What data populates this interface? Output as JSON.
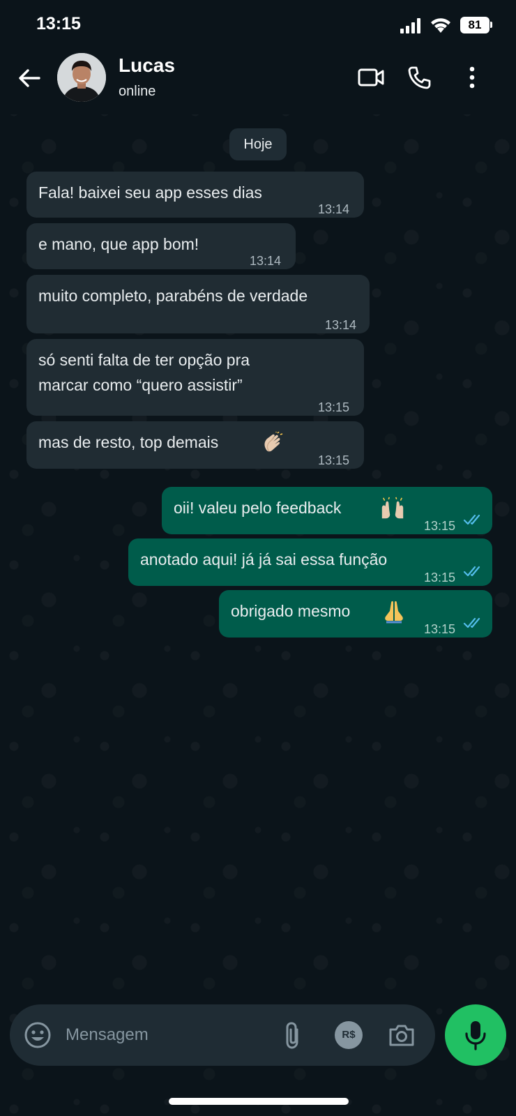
{
  "status_bar": {
    "time": "13:15",
    "battery": "81"
  },
  "header": {
    "contact_name": "Lucas",
    "contact_status": "online"
  },
  "date_chip": "Hoje",
  "messages": [
    {
      "direction": "in",
      "text": "Fala! baixei seu app esses dias",
      "time": "13:14"
    },
    {
      "direction": "in",
      "text": "e mano, que app bom!",
      "time": "13:14"
    },
    {
      "direction": "in",
      "text": "muito completo, parabéns de verdade",
      "time": "13:14"
    },
    {
      "direction": "in",
      "text_line1": "só senti falta de ter opção pra",
      "text_line2": "marcar como “quero assistir”",
      "time": "13:15"
    },
    {
      "direction": "in",
      "text": "mas de resto, top demais",
      "emoji": "clapping-hands",
      "time": "13:15"
    },
    {
      "direction": "out",
      "text": "oii! valeu pelo feedback",
      "emoji": "raising-hands",
      "time": "13:15",
      "status": "read"
    },
    {
      "direction": "out",
      "text": "anotado aqui! já já sai essa função",
      "time": "13:15",
      "status": "read"
    },
    {
      "direction": "out",
      "text": "obrigado mesmo",
      "emoji": "folded-hands",
      "time": "13:15",
      "status": "read"
    }
  ],
  "input": {
    "placeholder": "Mensagem",
    "payment_label": "R$"
  },
  "colors": {
    "background": "#0b141a",
    "incoming_bubble": "#202c33",
    "outgoing_bubble": "#005c4b",
    "read_tick": "#53bdeb",
    "mic_button": "#21c063"
  }
}
